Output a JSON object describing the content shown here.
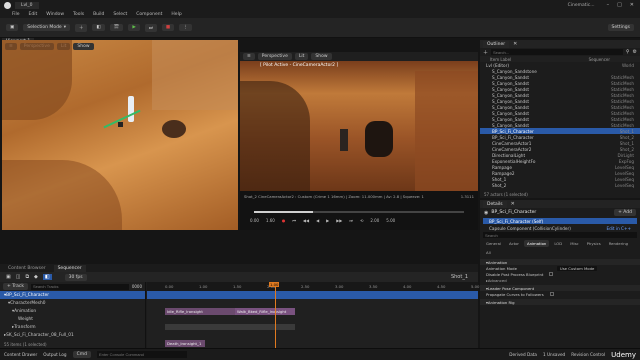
{
  "app": {
    "project": "Lvl_0",
    "window_title": "Cinematic...",
    "level_tab": "Walk_Bked_Rifle_Ironsight"
  },
  "menu": [
    "File",
    "Edit",
    "Window",
    "Tools",
    "Build",
    "Select",
    "Component",
    "Help"
  ],
  "toolbar": {
    "mode": "Selection Mode",
    "settings": "Settings"
  },
  "viewport": {
    "tab": "Viewport 1",
    "perspective": "Perspective",
    "lit": "Lit",
    "show": "Show"
  },
  "cine": {
    "perspective": "Perspective",
    "lit": "Lit",
    "show": "Show",
    "pilot": "[ Pilot Active - CineCameraActor2 ]",
    "info": "Shot_2  CineCameraActor2 : Custom (Crime 1 16mm) | Zoom: 11.000mm | Av: 2.8 | Squeeze: 1",
    "frame_right": "1.3111",
    "t0": "0.00",
    "t1": "1.60",
    "t2": "2.00",
    "t3": "5.00"
  },
  "outliner": {
    "tab": "Outliner",
    "search_placeholder": "Search...",
    "col_label": "Item Label",
    "col_type": "Sequencer",
    "rows": [
      {
        "label": "Lvl (Editor)",
        "type": "World"
      },
      {
        "label": "S_Canyon_Sandstone",
        "type": ""
      },
      {
        "label": "S_Canyon_Sandst",
        "type": "StaticMesh"
      },
      {
        "label": "S_Canyon_Sandst",
        "type": "StaticMesh"
      },
      {
        "label": "S_Canyon_Sandst",
        "type": "StaticMesh"
      },
      {
        "label": "S_Canyon_Sandst",
        "type": "StaticMesh"
      },
      {
        "label": "S_Canyon_Sandst",
        "type": "StaticMesh"
      },
      {
        "label": "S_Canyon_Sandst",
        "type": "StaticMesh"
      },
      {
        "label": "S_Canyon_Sandst",
        "type": "StaticMesh"
      },
      {
        "label": "S_Canyon_Sandst",
        "type": "StaticMesh"
      },
      {
        "label": "S_Canyon_Sandst",
        "type": "StaticMesh"
      },
      {
        "label": "BP_Sci_Fi_Character",
        "type": "Shot_1"
      },
      {
        "label": "BP_Sci_Fi_Character",
        "type": "Shot_2"
      },
      {
        "label": "CineCameraActor1",
        "type": "Shot_1"
      },
      {
        "label": "CineCameraActor2",
        "type": "Shot_2"
      },
      {
        "label": "DirectionalLight",
        "type": "DirLight"
      },
      {
        "label": "ExponentialHeightFo",
        "type": "ExpFog"
      },
      {
        "label": "Rampage",
        "type": "LevelSeq"
      },
      {
        "label": "Rampage2",
        "type": "LevelSeq"
      },
      {
        "label": "Shot_1",
        "type": "LevelSeq"
      },
      {
        "label": "Shot_2",
        "type": "LevelSeq"
      }
    ],
    "footer": "57 actors (1 selected)"
  },
  "details": {
    "tab": "Details",
    "title": "BP_Sci_Fi_Character",
    "add": "+ Add",
    "self": "BP_Sci_Fi_Character (Self)",
    "component": "Capsule Component (CollisionCylinder)",
    "edit": "Edit in C++",
    "search_placeholder": "Search",
    "tabs": [
      "General",
      "Actor",
      "Animation",
      "LOD",
      "Misc",
      "Physics",
      "Rendering",
      "All"
    ],
    "section1": "Animation",
    "props": [
      {
        "label": "Animation Mode",
        "value": "Use Custom Mode"
      },
      {
        "label": "Disable Post Process Blueprint",
        "value": ""
      }
    ],
    "section2": "Advanced",
    "section3": "Leader Pose Component",
    "prop3": "Propagate Curves to Followers",
    "section4": "Animation Rig"
  },
  "seq": {
    "tabs": [
      "Content Browser",
      "Sequencer"
    ],
    "fps": "30 fps",
    "shot": "Shot_1",
    "add_track": "+ Track",
    "search_placeholder": "Search Tracks",
    "time": "0000",
    "tracks": [
      "BP_Sci_Fi_Character",
      "CharacterMesh0",
      "Animation",
      "Weight",
      "Transform",
      "SK_Sci_Fi_Character_08_Full_01"
    ],
    "footer": "55 items (1 selected)",
    "ruler": [
      "0.00",
      "1.00",
      "1.50",
      "2.00",
      "2.50",
      "3.00",
      "3.50",
      "4.00",
      "4.50",
      "5.00"
    ],
    "clip1": "Idle_Rifle_Ironsight",
    "clip2": "Walk_Bked_Rifle_Ironsight",
    "clip3": "Death_Ironsight_1",
    "playhead": "1.00"
  },
  "status": {
    "cb": "Content Drawer",
    "log": "Output Log",
    "cmd": "Cmd",
    "console": "Enter Console Command",
    "derived": "Derived Data",
    "unsaved": "1 Unsaved",
    "revision": "Revision Control",
    "watermark": "Udemy"
  }
}
